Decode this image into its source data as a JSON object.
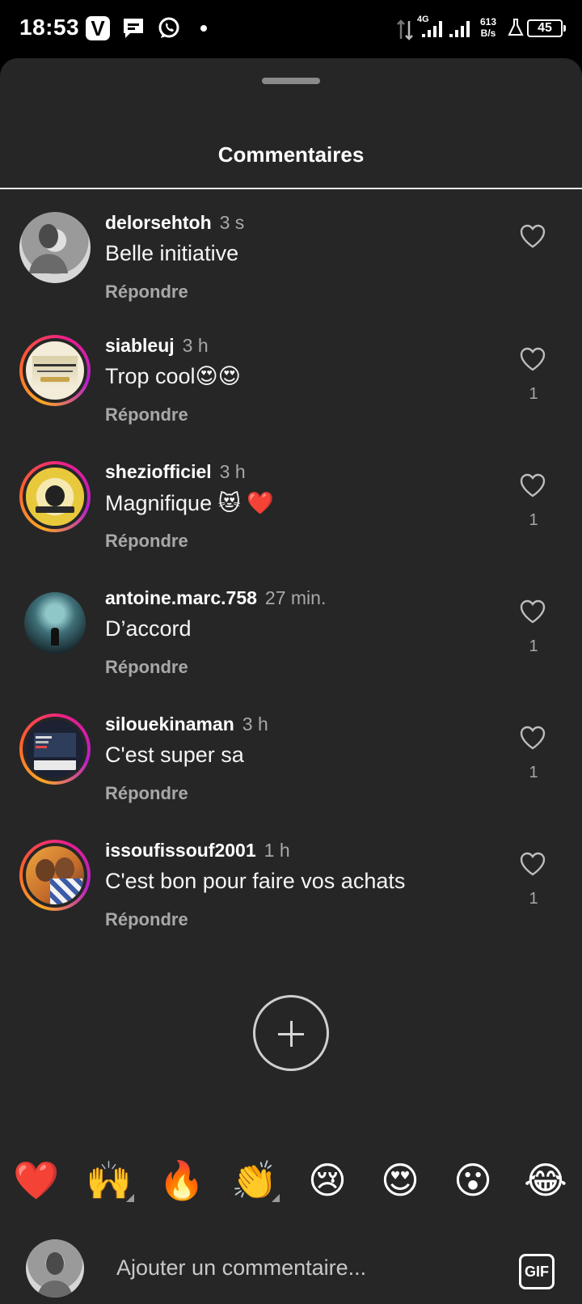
{
  "status_bar": {
    "time": "18:53",
    "network": "4G",
    "speed_value": "613",
    "speed_unit": "B/s",
    "battery": "45"
  },
  "sheet": {
    "title": "Commentaires"
  },
  "comments": [
    {
      "username": "delorsehtoh",
      "time": "3 s",
      "text": "Belle initiative",
      "reply": "Répondre",
      "likes": ""
    },
    {
      "username": "siableuj",
      "time": "3 h",
      "text": "Trop cool😍😍",
      "reply": "Répondre",
      "likes": "1"
    },
    {
      "username": "sheziofficiel",
      "time": "3 h",
      "text": "Magnifique 😻 ❤️",
      "reply": "Répondre",
      "likes": "1"
    },
    {
      "username": "antoine.marc.758",
      "time": "27 min.",
      "text": "D’accord",
      "reply": "Répondre",
      "likes": "1"
    },
    {
      "username": "silouekinaman",
      "time": "3 h",
      "text": "C'est super sa",
      "reply": "Répondre",
      "likes": "1"
    },
    {
      "username": "issoufissouf2001",
      "time": "1 h",
      "text": "C'est bon pour faire vos achats",
      "reply": "Répondre",
      "likes": "1"
    }
  ],
  "quick_reactions": [
    "❤️",
    "🙌",
    "🔥",
    "👏",
    "😢",
    "😍",
    "😮",
    "😂"
  ],
  "input": {
    "placeholder": "Ajouter un commentaire...",
    "gif_label": "GIF"
  },
  "colors": {
    "sheet_bg": "#262626",
    "secondary_text": "#a8a8a8",
    "story_ring": "#e91e8c"
  }
}
